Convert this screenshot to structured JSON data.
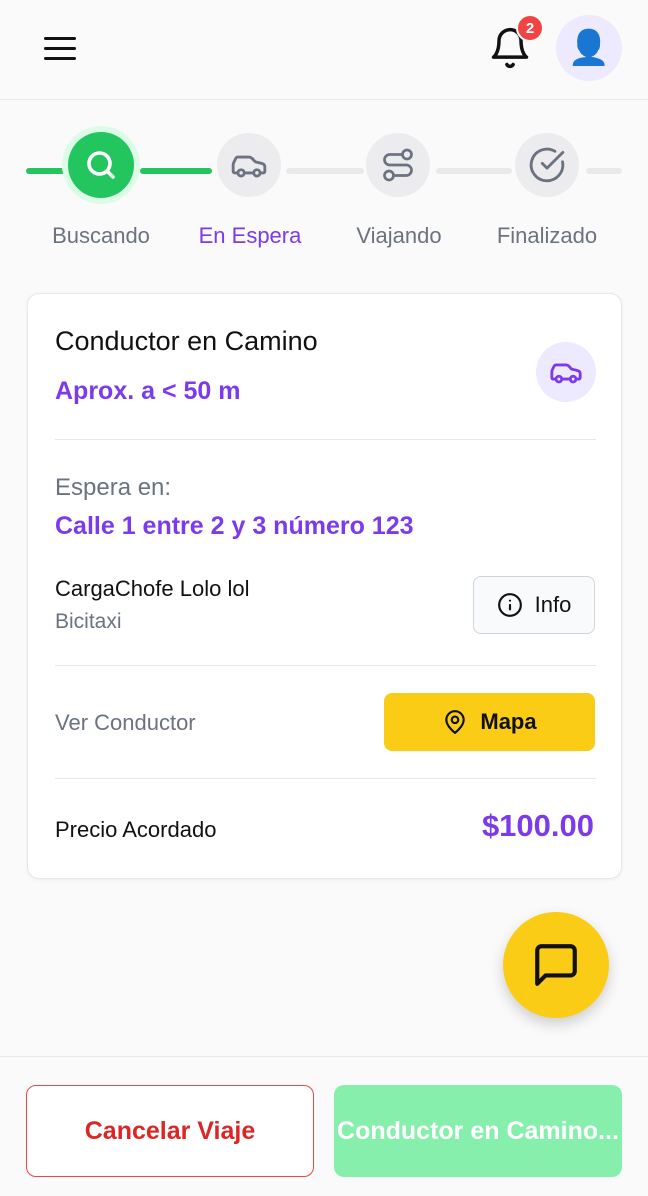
{
  "header": {
    "notifications_count": "2",
    "avatar_glyph": "👤"
  },
  "steps": [
    {
      "label": "Buscando",
      "icon": "search-icon",
      "state": "done"
    },
    {
      "label": "En Espera",
      "icon": "car-icon",
      "state": "current"
    },
    {
      "label": "Viajando",
      "icon": "route-icon",
      "state": "pending"
    },
    {
      "label": "Finalizado",
      "icon": "check-circle-icon",
      "state": "pending"
    }
  ],
  "card": {
    "title": "Conductor en Camino",
    "distance": "Aprox. a < 50 m",
    "wait_label": "Espera en:",
    "wait_address": "Calle 1 entre 2 y 3 número 123",
    "driver_name": "CargaChofe Lolo lol",
    "vehicle_type": "Bicitaxi",
    "info_button": "Info",
    "view_driver_label": "Ver Conductor",
    "map_button": "Mapa",
    "price_label": "Precio Acordado",
    "price_value": "$100.00"
  },
  "footer": {
    "cancel_button": "Cancelar Viaje",
    "status_button": "Conductor en Camino..."
  },
  "colors": {
    "accent": "#7c3aed",
    "success": "#22c55e",
    "warning": "#facc15",
    "danger": "#ef4444"
  }
}
